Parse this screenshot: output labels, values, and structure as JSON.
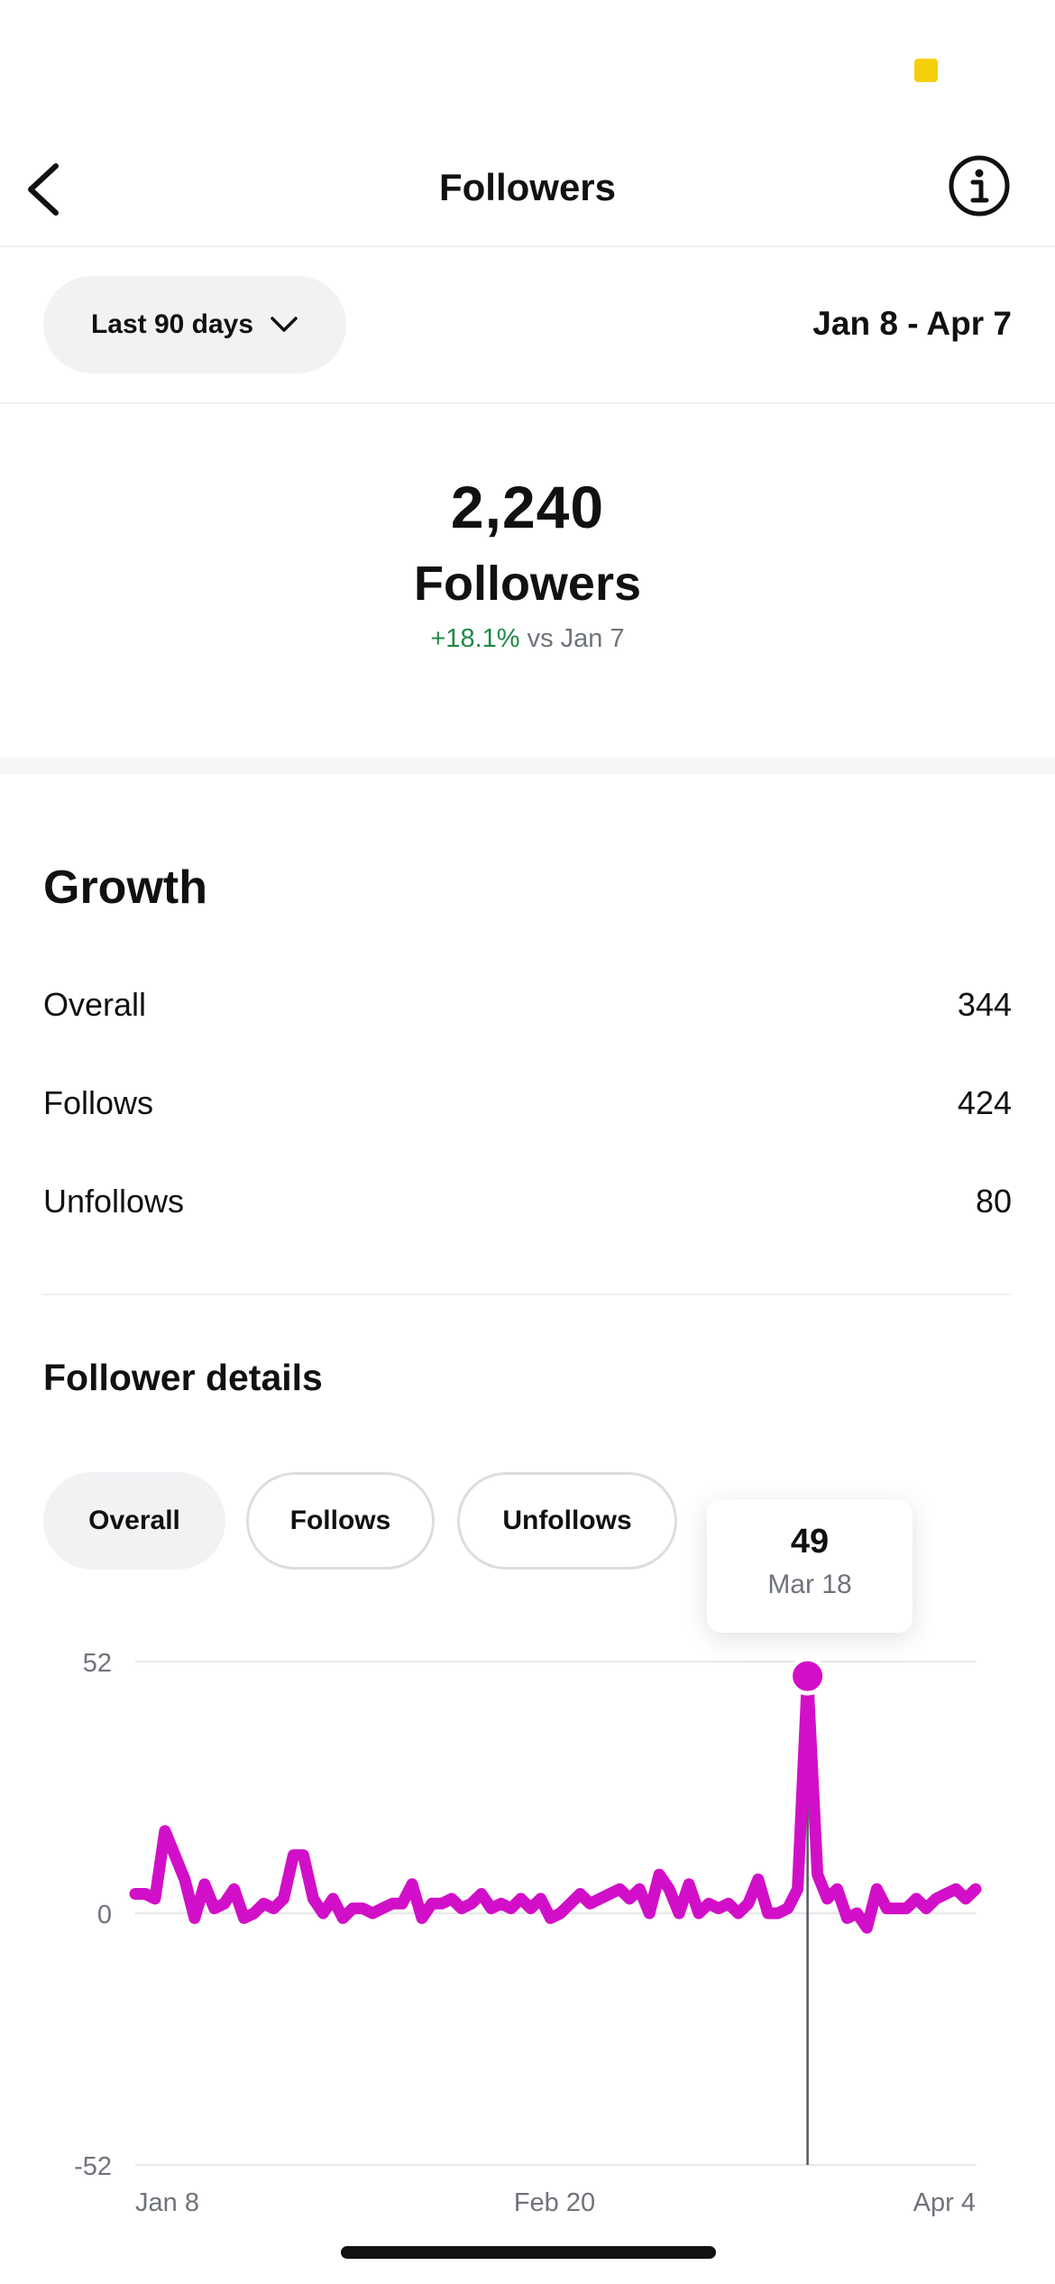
{
  "nav": {
    "title": "Followers"
  },
  "range": {
    "selector_label": "Last 90 days",
    "dates": "Jan 8 - Apr 7"
  },
  "summary": {
    "count": "2,240",
    "label": "Followers",
    "change": "+18.1%",
    "change_suffix": "vs Jan 7"
  },
  "growth": {
    "title": "Growth",
    "rows": [
      {
        "label": "Overall",
        "value": "344"
      },
      {
        "label": "Follows",
        "value": "424"
      },
      {
        "label": "Unfollows",
        "value": "80"
      }
    ]
  },
  "details": {
    "title": "Follower details",
    "tabs": [
      {
        "label": "Overall",
        "active": true
      },
      {
        "label": "Follows",
        "active": false
      },
      {
        "label": "Unfollows",
        "active": false
      }
    ]
  },
  "tooltip": {
    "value": "49",
    "date": "Mar 18"
  },
  "colors": {
    "series": "#d20fc8",
    "positive": "#1f8a43",
    "status_indicator": "#f5cf0a"
  },
  "icons": {
    "back": "chevron-left-icon",
    "info": "info-circle-icon",
    "dropdown": "chevron-down-icon"
  },
  "chart_data": {
    "type": "line",
    "y_ticks": [
      "52",
      "0",
      "-52"
    ],
    "x_ticks": [
      "Jan 8",
      "Feb 20",
      "Apr 4"
    ],
    "ylim": [
      -52,
      52
    ],
    "grid": true,
    "highlight": {
      "x": "Mar 18",
      "y": 49
    },
    "series": [
      {
        "values": [
          4,
          4,
          3,
          17,
          12,
          7,
          -1,
          6,
          1,
          2,
          5,
          -1,
          0,
          2,
          1,
          3,
          12,
          12,
          3,
          0,
          3,
          -1,
          1,
          1,
          0,
          1,
          2,
          2,
          6,
          -1,
          2,
          2,
          3,
          1,
          2,
          4,
          1,
          2,
          1,
          3,
          1,
          3,
          -1,
          0,
          2,
          4,
          2,
          3,
          4,
          5,
          3,
          5,
          0,
          8,
          5,
          0,
          6,
          0,
          2,
          1,
          2,
          0,
          2,
          7,
          0,
          0,
          1,
          5,
          49,
          8,
          3,
          5,
          -1,
          0,
          -3,
          5,
          1,
          1,
          1,
          3,
          1,
          3,
          4,
          5,
          3,
          5
        ]
      }
    ]
  }
}
